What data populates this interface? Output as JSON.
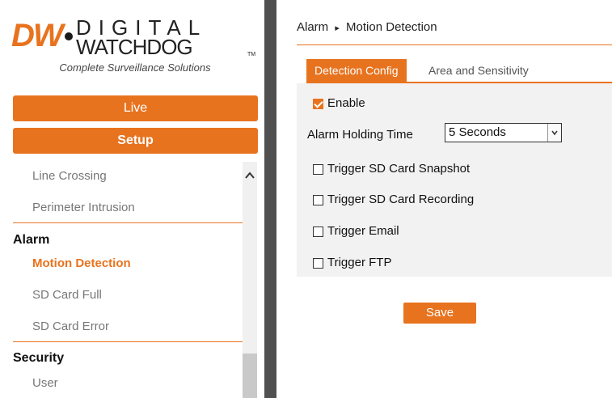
{
  "logo": {
    "mark": "DW",
    "line1": "DIGITAL",
    "line2": "WATCHDOG",
    "tm": "TM",
    "tagline": "Complete Surveillance Solutions"
  },
  "nav": {
    "live_label": "Live",
    "setup_label": "Setup"
  },
  "menu": {
    "items_top": [
      "Line Crossing",
      "Perimeter Intrusion"
    ],
    "alarm_heading": "Alarm",
    "alarm_items": [
      "Motion Detection",
      "SD Card Full",
      "SD Card Error"
    ],
    "security_heading": "Security",
    "security_items": [
      "User"
    ],
    "active": "Motion Detection"
  },
  "breadcrumb": {
    "section": "Alarm",
    "separator": "▸",
    "page": "Motion Detection"
  },
  "tabs": [
    {
      "label": "Detection Config",
      "active": true
    },
    {
      "label": "Area and Sensitivity",
      "active": false
    }
  ],
  "config": {
    "enable_label": "Enable",
    "enable_checked": true,
    "holding_label": "Alarm Holding Time",
    "holding_value": "5 Seconds",
    "triggers": [
      {
        "label": "Trigger SD Card Snapshot",
        "checked": false
      },
      {
        "label": "Trigger SD Card Recording",
        "checked": false
      },
      {
        "label": "Trigger Email",
        "checked": false
      },
      {
        "label": "Trigger FTP",
        "checked": false
      }
    ]
  },
  "save_label": "Save",
  "colors": {
    "accent": "#e8731f",
    "divider": "#505050",
    "panel": "#f2f2f2"
  }
}
